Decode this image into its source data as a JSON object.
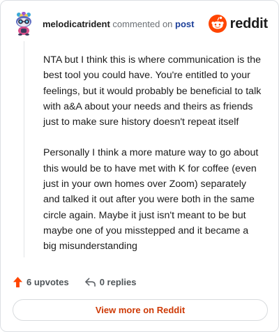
{
  "header": {
    "username": "melodicatrident",
    "commented_text": "commented on",
    "post_link": "post",
    "brand": "reddit"
  },
  "comment": {
    "paragraphs": [
      "NTA but I think this is where communication is the best tool you could have. You're entitled to your feelings, but it would probably be beneficial to talk with a&A about your needs and theirs as friends just to make sure history doesn't repeat itself",
      "Personally I think a more mature way to go about this would be to have met with K for coffee (even just in your own homes over Zoom) separately and talked it out after you were both in the same circle again. Maybe it just isn't meant to be but maybe one of you misstepped and it became a big misunderstanding"
    ]
  },
  "actions": {
    "upvotes": "6 upvotes",
    "replies": "0 replies"
  },
  "footer": {
    "view_more": "View more on Reddit"
  },
  "colors": {
    "brand_orange": "#ff4500",
    "upvote_orange": "#ff4500",
    "link_blue": "#1c3f99",
    "view_more_text": "#ce3a06"
  },
  "icons": {
    "avatar": "snoo-avatar-icon",
    "brand": "reddit-logo-icon",
    "upvote": "upvote-arrow-icon",
    "reply": "reply-arrow-icon"
  }
}
